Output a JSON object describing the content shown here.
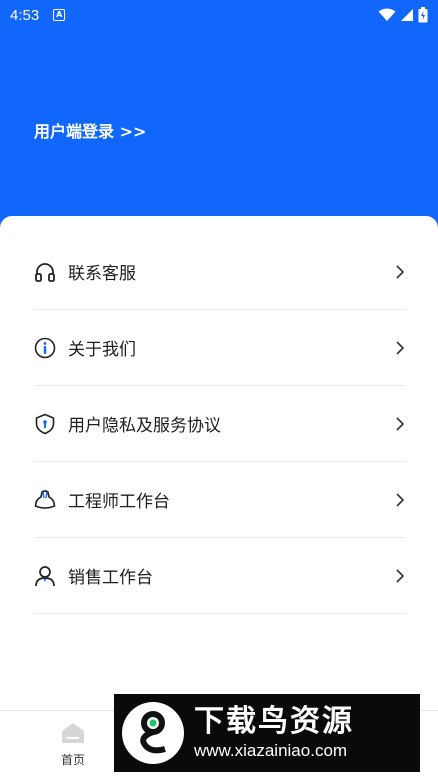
{
  "status_bar": {
    "time": "4:53",
    "notification_glyph": "A"
  },
  "header": {
    "login_text": "用户端登录 >>"
  },
  "menu": {
    "items": [
      {
        "label": "联系客服",
        "icon": "headset-icon"
      },
      {
        "label": "关于我们",
        "icon": "info-icon"
      },
      {
        "label": "用户隐私及服务协议",
        "icon": "shield-icon"
      },
      {
        "label": "工程师工作台",
        "icon": "engineer-icon"
      },
      {
        "label": "销售工作台",
        "icon": "person-icon"
      }
    ]
  },
  "tab_bar": {
    "home_label": "首页"
  },
  "watermark": {
    "title": "下载鸟资源",
    "url": "www.xiazainiao.com"
  },
  "colors": {
    "primary": "#1167fb",
    "icon_accent": "#1167fb",
    "text": "#1e1e1e",
    "divider": "#ececec"
  }
}
